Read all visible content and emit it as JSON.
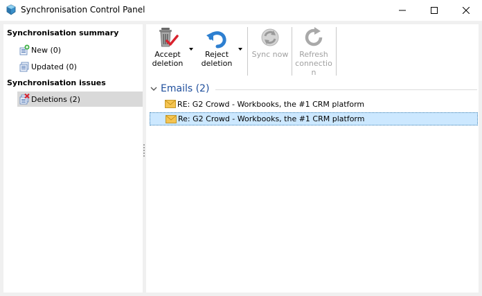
{
  "window": {
    "title": "Synchronisation Control Panel"
  },
  "sidebar": {
    "summary_heading": "Synchronisation summary",
    "summary_items": [
      {
        "label": "New (0)"
      },
      {
        "label": "Updated (0)"
      }
    ],
    "issues_heading": "Synchronisation issues",
    "issues_items": [
      {
        "label": "Deletions (2)",
        "selected": true
      }
    ]
  },
  "toolbar": {
    "accept_line1": "Accept",
    "accept_line2": "deletion",
    "reject_line1": "Reject",
    "reject_line2": "deletion",
    "sync_now": "Sync now",
    "refresh_line1": "Refresh",
    "refresh_line2": "connectio",
    "refresh_line3": "n"
  },
  "group": {
    "title": "Emails (2)"
  },
  "emails": [
    {
      "subject": "RE: G2 Crowd - Workbooks, the #1 CRM platform"
    },
    {
      "subject": "Re: G2 Crowd - Workbooks, the #1 CRM platform",
      "selected": true
    }
  ],
  "colors": {
    "group_title": "#1e4e9c",
    "selection_bg": "#cce8ff",
    "tree_selection_bg": "#d9d9d9"
  }
}
